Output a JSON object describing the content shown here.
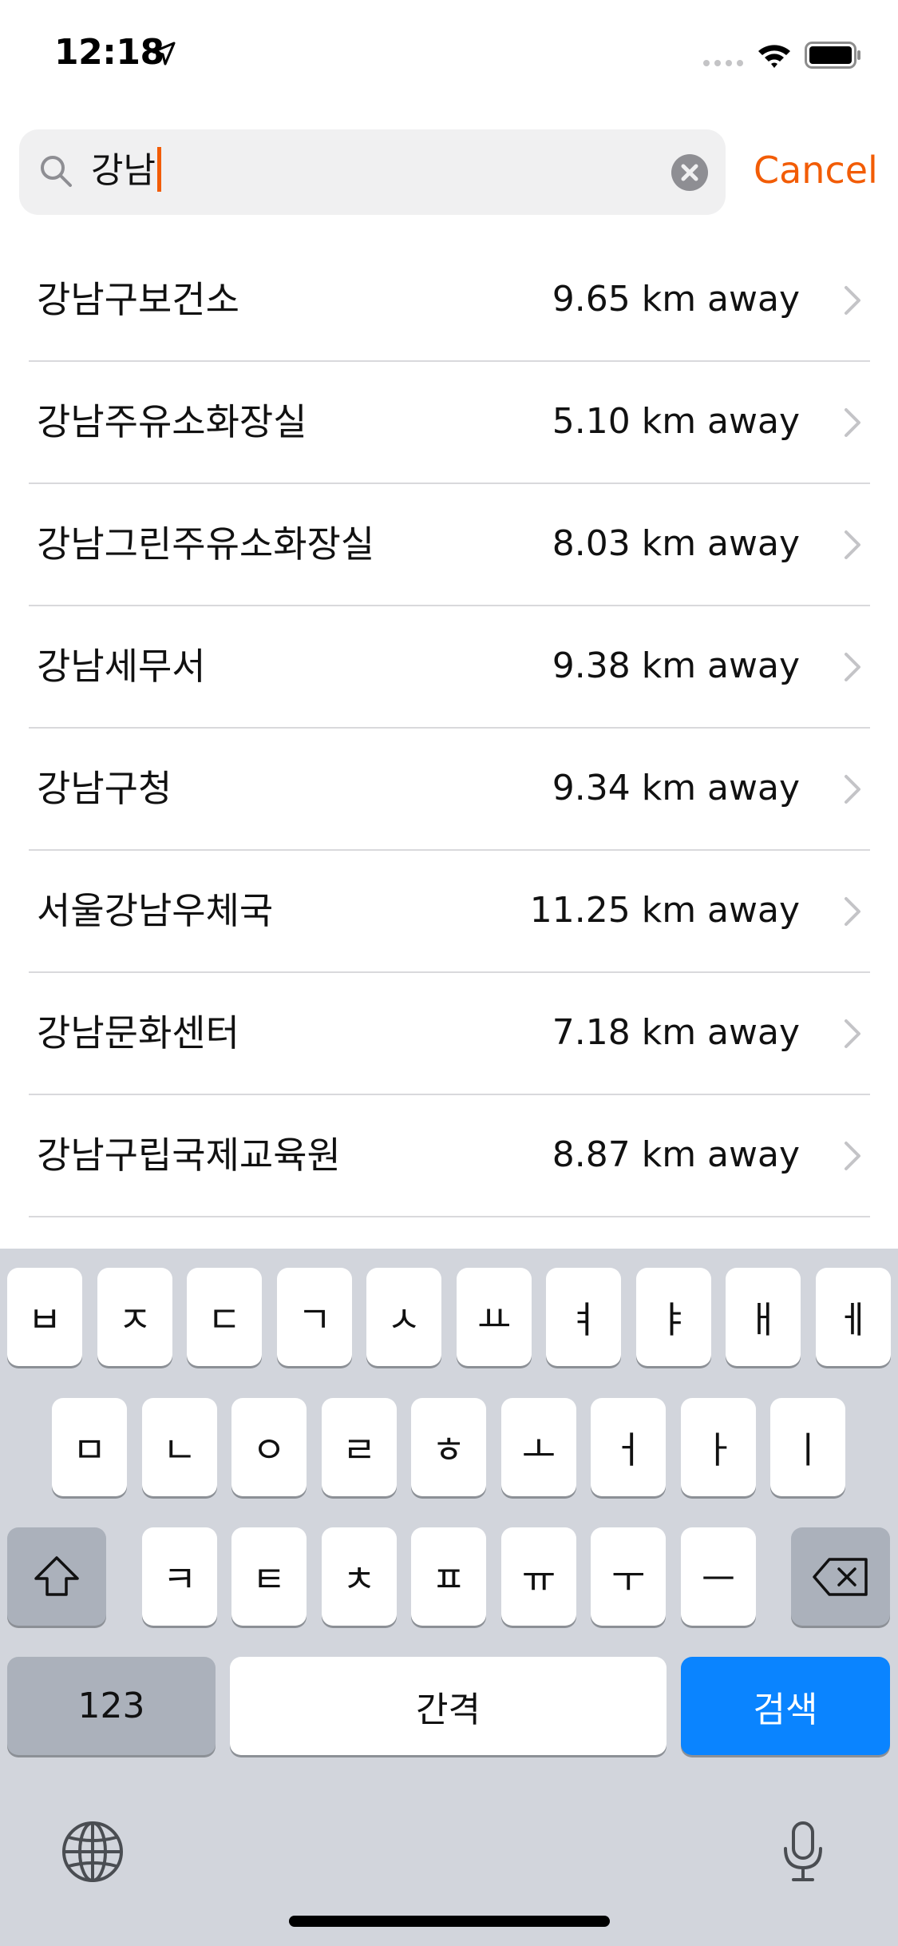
{
  "status_bar": {
    "time": "12:18"
  },
  "search": {
    "query": "강남",
    "cancel_label": "Cancel"
  },
  "results": [
    {
      "name": "강남구보건소",
      "distance": "9.65 km away"
    },
    {
      "name": "강남주유소화장실",
      "distance": "5.10 km away"
    },
    {
      "name": "강남그린주유소화장실",
      "distance": "8.03 km away"
    },
    {
      "name": "강남세무서",
      "distance": "9.38 km away"
    },
    {
      "name": "강남구청",
      "distance": "9.34 km away"
    },
    {
      "name": "서울강남우체국",
      "distance": "11.25 km away"
    },
    {
      "name": "강남문화센터",
      "distance": "7.18 km away"
    },
    {
      "name": "강남구립국제교육원",
      "distance": "8.87 km away"
    }
  ],
  "keyboard": {
    "row1": [
      "ㅂ",
      "ㅈ",
      "ㄷ",
      "ㄱ",
      "ㅅ",
      "ㅛ",
      "ㅕ",
      "ㅑ",
      "ㅐ",
      "ㅔ"
    ],
    "row2": [
      "ㅁ",
      "ㄴ",
      "ㅇ",
      "ㄹ",
      "ㅎ",
      "ㅗ",
      "ㅓ",
      "ㅏ",
      "ㅣ"
    ],
    "row3": [
      "ㅋ",
      "ㅌ",
      "ㅊ",
      "ㅍ",
      "ㅠ",
      "ㅜ",
      "ㅡ"
    ],
    "numbers_label": "123",
    "space_label": "간격",
    "search_label": "검색"
  },
  "colors": {
    "accent": "#f25c05",
    "keyboard_bg": "#d2d5dc",
    "search_key": "#0a84ff"
  }
}
